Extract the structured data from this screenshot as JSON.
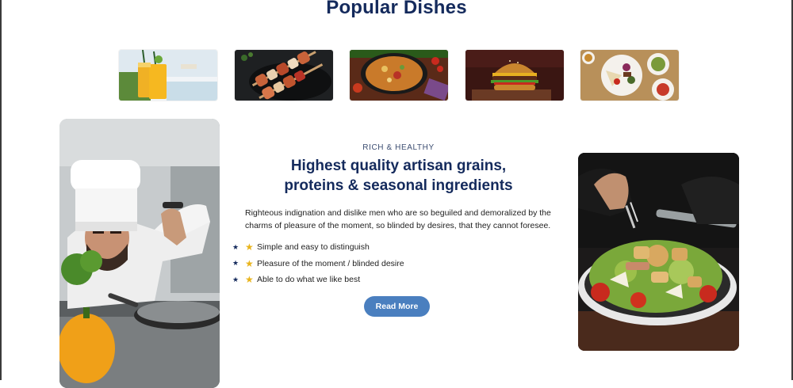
{
  "section": {
    "title": "Popular Dishes"
  },
  "dishes": [
    {
      "name": "drinks-icon"
    },
    {
      "name": "skewers-icon"
    },
    {
      "name": "paella-icon"
    },
    {
      "name": "burger-icon"
    },
    {
      "name": "platter-icon"
    }
  ],
  "feature_block": {
    "eyebrow": "RICH & HEALTHY",
    "headline": "Highest quality artisan grains, proteins & seasonal ingredients",
    "body": "Righteous indignation and dislike men who are so beguiled and demoralized by the charms of pleasure of the moment, so blinded by desires, that they cannot foresee.",
    "features": [
      {
        "label": "Simple and easy to distinguish"
      },
      {
        "label": "Pleasure of the moment / blinded desire"
      },
      {
        "label": "Able to do what we like best"
      }
    ],
    "button_label": "Read More"
  },
  "colors": {
    "heading": "#142a5c",
    "button": "#4a7fbf",
    "star": "#e9b41c"
  }
}
